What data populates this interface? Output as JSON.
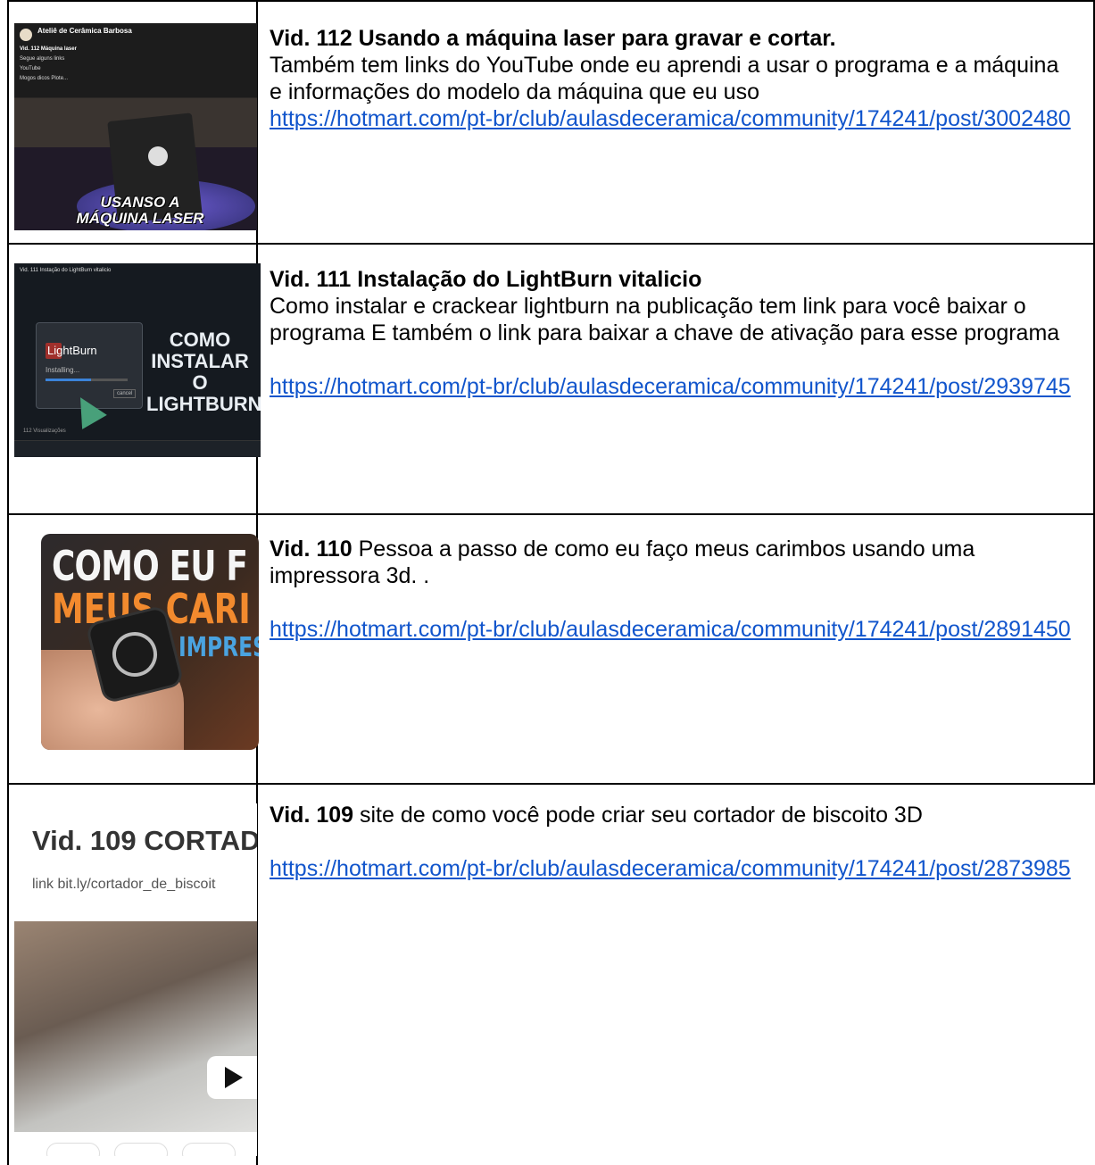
{
  "rows": [
    {
      "title": "Vid. 112 Usando a máquina laser para gravar e cortar.",
      "description": "Também tem links do YouTube onde eu aprendi a usar o programa e a máquina e informações do modelo da máquina que eu uso",
      "link": "https://hotmart.com/pt-br/club/aulasdeceramica/community/174241/post/3002480",
      "thumb": {
        "channel": "Ateliê de Cerâmica Barbosa",
        "post_title": "Vid. 112 Máquina laser",
        "line1": "Segue alguns links",
        "line2": "YouTube",
        "line3": "Mogos dicos Plote...",
        "caption": "USANSO A MÁQUINA LASER"
      }
    },
    {
      "title": "Vid. 111  Instalação do LightBurn vitalicio",
      "description": "Como instalar e crackear lightburn na publicação tem link para você baixar o programa E também o link para baixar a chave de ativação para esse programa",
      "link": "https://hotmart.com/pt-br/club/aulasdeceramica/community/174241/post/2939745",
      "thumb": {
        "post_title": "Vid. 111 Instação do LightBurn vitalicio",
        "app_name": "LightBurn",
        "installing": "Installing...",
        "cancel": "cancel",
        "caption": "COMO INSTALAR O LIGHTBURN",
        "views": "112 Visualizações"
      }
    },
    {
      "title": "Vid. 110",
      "description": " Pessoa a passo de como eu faço meus carimbos usando uma impressora 3d. .",
      "link": "https://hotmart.com/pt-br/club/aulasdeceramica/community/174241/post/2891450",
      "thumb": {
        "line1": "COMO EU F",
        "line2": "MEUS CARI",
        "line3": "IMPRES"
      }
    },
    {
      "title": "Vid. 109",
      "description": " site de como você pode criar seu cortador de biscoito 3D",
      "link": "https://hotmart.com/pt-br/club/aulasdeceramica/community/174241/post/2873985",
      "thumb": {
        "title": "Vid. 109 CORTAD",
        "link_text": "link bit.ly/cortador_de_biscoit"
      }
    }
  ]
}
